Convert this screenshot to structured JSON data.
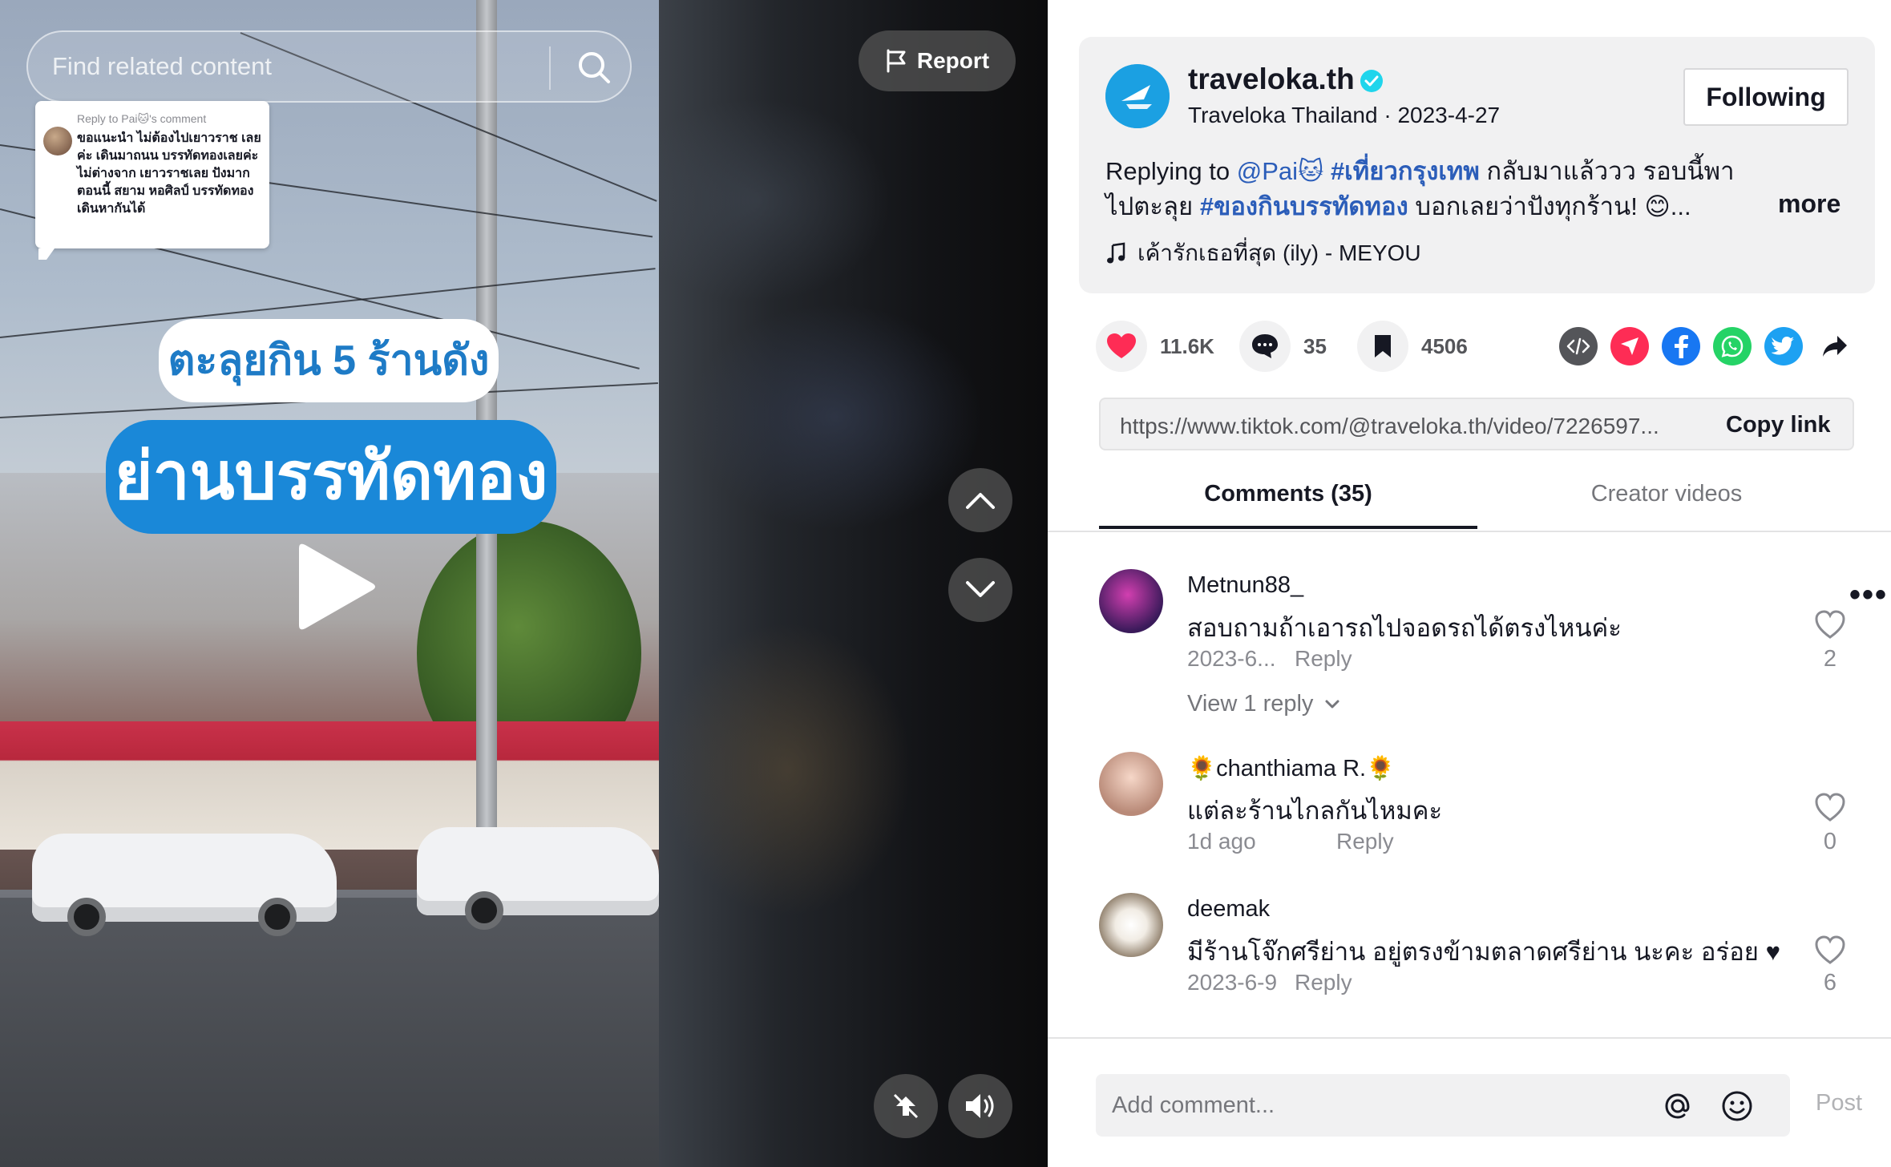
{
  "video": {
    "search_placeholder": "Find related content",
    "reply_card": {
      "header": "Reply to Pai🐱's comment",
      "text": "ขอแนะนำ ไม่ต้องไปเยาวราช เลยค่ะ เดินมาถนน บรรทัดทองเลยค่ะ ไม่ต่างจาก เยาวราชเลย ปังมากตอนนี้ สยาม หอศิลป์ บรรทัดทอง เดินหากันได้"
    },
    "caption_line_1": "ตะลุยกิน 5 ร้านดัง",
    "caption_line_2": "ย่านบรรทัดทอง",
    "report_label": "Report"
  },
  "post": {
    "creator_handle": "traveloka.th",
    "creator_name": "Traveloka Thailand",
    "separator": " · ",
    "date": "2023-4-27",
    "follow_label": "Following",
    "caption": {
      "prefix": "Replying to ",
      "mention": "@Pai🐱",
      "tag_1": "#เที่ยวกรุงเทพ",
      "text_1": " กลับมาแล้ววว รอบนี้พาไปตะลุย ",
      "tag_2": "#ของกินบรรทัดทอง",
      "text_2": " บอกเลยว่าปังทุกร้าน! 😊..."
    },
    "more_label": "more",
    "music": "เค้ารักเธอที่สุด (ily) - MEYOU"
  },
  "stats": {
    "likes": "11.6K",
    "comments": "35",
    "saves": "4506"
  },
  "share": {
    "url": "https://www.tiktok.com/@traveloka.th/video/7226597...",
    "copy_label": "Copy link"
  },
  "tabs": {
    "comments": "Comments (35)",
    "creator_videos": "Creator videos"
  },
  "comments": [
    {
      "author": "Metnun88_",
      "text": "สอบถามถ้าเอารถไปจอดรถได้ตรงไหนค่ะ",
      "date": "2023-6...",
      "reply": "Reply",
      "likes": "2",
      "view_replies": "View 1 reply"
    },
    {
      "author": "🌻chanthiama R.🌻",
      "text": "แต่ละร้านไกลกันไหมคะ",
      "date": "1d ago",
      "reply": "Reply",
      "likes": "0"
    },
    {
      "author": "deemak",
      "text": "มีร้านโจ๊กศรีย่าน อยู่ตรงข้ามตลาดศรีย่าน นะคะ อร่อย ♥",
      "date": "2023-6-9",
      "reply": "Reply",
      "likes": "6"
    }
  ],
  "composer": {
    "placeholder": "Add comment...",
    "post_label": "Post"
  },
  "colors": {
    "like_red": "#fe2c55",
    "tag_blue": "#2b5db9",
    "verified": "#20d5ec"
  },
  "icons": [
    "search-icon",
    "flag-icon",
    "play-icon",
    "chevron-up-icon",
    "chevron-down-icon",
    "float-player-icon",
    "volume-icon",
    "verified-icon",
    "music-note-icon",
    "heart-icon",
    "comment-icon",
    "bookmark-icon",
    "embed-icon",
    "send-icon",
    "facebook-icon",
    "whatsapp-icon",
    "twitter-icon",
    "share-arrow-icon",
    "more-dots-icon",
    "like-outline-icon",
    "at-icon",
    "emoji-icon"
  ]
}
